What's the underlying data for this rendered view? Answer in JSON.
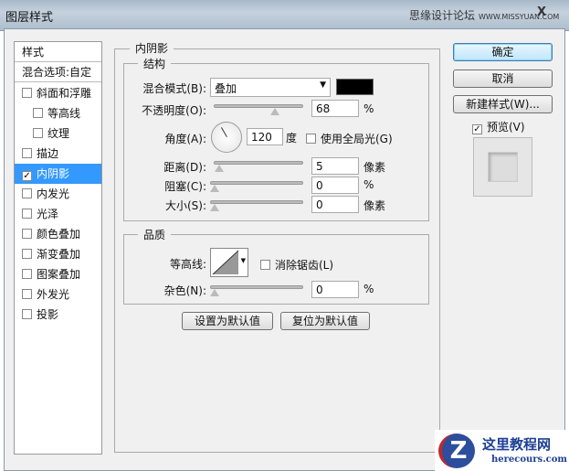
{
  "window": {
    "title": "图层样式",
    "watermark_cn": "思缘设计论坛",
    "watermark_url": "WWW.MISSYUAN.COM",
    "close": "X"
  },
  "sidebar": {
    "header": "样式",
    "blend_options": "混合选项:自定",
    "items": [
      {
        "label": "斜面和浮雕",
        "checked": false
      },
      {
        "label": "等高线",
        "checked": false
      },
      {
        "label": "纹理",
        "checked": false
      },
      {
        "label": "描边",
        "checked": false
      },
      {
        "label": "内阴影",
        "checked": true
      },
      {
        "label": "内发光",
        "checked": false
      },
      {
        "label": "光泽",
        "checked": false
      },
      {
        "label": "颜色叠加",
        "checked": false
      },
      {
        "label": "渐变叠加",
        "checked": false
      },
      {
        "label": "图案叠加",
        "checked": false
      },
      {
        "label": "外发光",
        "checked": false
      },
      {
        "label": "投影",
        "checked": false
      }
    ]
  },
  "main": {
    "section_title": "内阴影",
    "structure": {
      "title": "结构",
      "blend_mode_label": "混合模式(B):",
      "blend_mode_value": "叠加",
      "color": "#000000",
      "opacity_label": "不透明度(O):",
      "opacity_value": "68",
      "opacity_unit": "%",
      "opacity_fraction": 0.68,
      "angle_label": "角度(A):",
      "angle_value": "120",
      "angle_unit": "度",
      "global_light_label": "使用全局光(G)",
      "global_light_checked": false,
      "distance_label": "距离(D):",
      "distance_value": "5",
      "distance_unit": "像素",
      "choke_label": "阻塞(C):",
      "choke_value": "0",
      "choke_unit": "%",
      "size_label": "大小(S):",
      "size_value": "0",
      "size_unit": "像素"
    },
    "quality": {
      "title": "品质",
      "contour_label": "等高线:",
      "antialias_label": "消除锯齿(L)",
      "antialias_checked": false,
      "noise_label": "杂色(N):",
      "noise_value": "0",
      "noise_unit": "%"
    },
    "make_default": "设置为默认值",
    "reset_default": "复位为默认值"
  },
  "buttons": {
    "ok": "确定",
    "cancel": "取消",
    "new_style": "新建样式(W)...",
    "preview_label": "预览(V)",
    "preview_checked": true
  },
  "logo": {
    "cn": "这里教程网",
    "url": "herecours.com"
  }
}
